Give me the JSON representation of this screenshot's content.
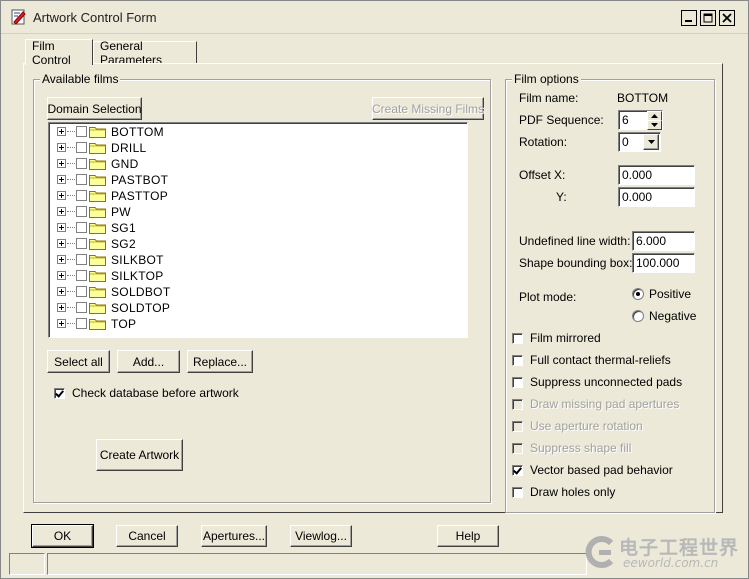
{
  "window": {
    "title": "Artwork Control Form",
    "minimize_icon": "minimize-icon",
    "maximize_icon": "maximize-icon",
    "close_icon": "close-icon"
  },
  "tabs": [
    {
      "label": "Film Control",
      "active": true
    },
    {
      "label": "General Parameters",
      "active": false
    }
  ],
  "available_films": {
    "legend": "Available films",
    "domain_selection_label": "Domain Selection",
    "create_missing_label": "Create Missing Films",
    "films": [
      "BOTTOM",
      "DRILL",
      "GND",
      "PASTBOT",
      "PASTTOP",
      "PW",
      "SG1",
      "SG2",
      "SILKBOT",
      "SILKTOP",
      "SOLDBOT",
      "SOLDTOP",
      "TOP"
    ],
    "select_all_label": "Select all",
    "add_label": "Add...",
    "replace_label": "Replace...",
    "check_db_label": "Check database before artwork",
    "check_db_checked": true,
    "create_artwork_label": "Create Artwork"
  },
  "film_options": {
    "legend": "Film options",
    "film_name_label": "Film name:",
    "film_name_value": "BOTTOM",
    "pdf_sequence_label": "PDF Sequence:",
    "pdf_sequence_value": "6",
    "rotation_label": "Rotation:",
    "rotation_value": "0",
    "offset_label": "Offset",
    "offset_x_label": "X:",
    "offset_x_value": "0.000",
    "offset_y_label": "Y:",
    "offset_y_value": "0.000",
    "undefined_line_width_label": "Undefined line width:",
    "undefined_line_width_value": "6.000",
    "shape_bounding_box_label": "Shape bounding box:",
    "shape_bounding_box_value": "100.000",
    "plot_mode_label": "Plot mode:",
    "positive_label": "Positive",
    "negative_label": "Negative",
    "plot_mode_selected": "Positive",
    "checkboxes": [
      {
        "label": "Film mirrored",
        "checked": false,
        "enabled": true
      },
      {
        "label": "Full contact thermal-reliefs",
        "checked": false,
        "enabled": true
      },
      {
        "label": "Suppress unconnected pads",
        "checked": false,
        "enabled": true
      },
      {
        "label": "Draw missing pad apertures",
        "checked": false,
        "enabled": false
      },
      {
        "label": "Use aperture rotation",
        "checked": false,
        "enabled": false
      },
      {
        "label": "Suppress shape fill",
        "checked": false,
        "enabled": false
      },
      {
        "label": "Vector based pad behavior",
        "checked": true,
        "enabled": true
      },
      {
        "label": "Draw holes only",
        "checked": false,
        "enabled": true
      }
    ]
  },
  "footer": {
    "ok_label": "OK",
    "cancel_label": "Cancel",
    "apertures_label": "Apertures...",
    "viewlog_label": "Viewlog...",
    "help_label": "Help"
  },
  "watermark": {
    "text_cn": "电子工程世界",
    "text_url": "eeworld.com.cn"
  },
  "colors": {
    "face": "#ece9d8",
    "folder": "#ffff99",
    "folder_edge": "#8b7a00"
  }
}
